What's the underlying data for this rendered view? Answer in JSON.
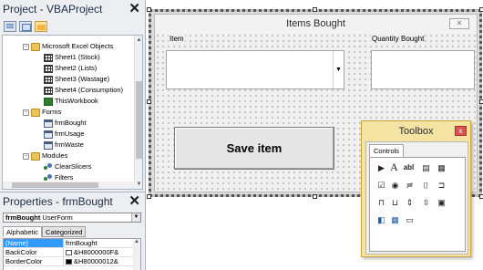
{
  "project": {
    "title": "Project - VBAProject",
    "close": "✕",
    "items": {
      "excel_objects": "Microsoft Excel Objects",
      "sheet1": "Sheet1 (Stock)",
      "sheet2": "Sheet2 (Lists)",
      "sheet3": "Sheet3 (Wastage)",
      "sheet4": "Sheet4 (Consumption)",
      "workbook": "ThisWorkbook",
      "forms": "Forms",
      "frm_bought": "frmBought",
      "frm_usage": "frmUsage",
      "frm_waste": "frmWaste",
      "modules": "Modules",
      "clear_slicers": "ClearSlicers",
      "filters": "Filters"
    }
  },
  "properties": {
    "title": "Properties - frmBought",
    "close": "✕",
    "object_name": "frmBought",
    "object_type": "UserForm",
    "tabs": {
      "alphabetic": "Alphabetic",
      "categorized": "Categorized"
    },
    "rows": [
      {
        "name": "(Name)",
        "value": "frmBought",
        "swatch": ""
      },
      {
        "name": "BackColor",
        "value": "&H8000000F&",
        "swatch": "#ffffff"
      },
      {
        "name": "BorderColor",
        "value": "&H80000012&",
        "swatch": "#000000"
      }
    ]
  },
  "userform": {
    "title": "Items Bought",
    "close": "✕",
    "item_label": "Item",
    "quantity_label": "Quantity Bought",
    "save_button": "Save item"
  },
  "toolbox": {
    "title": "Toolbox",
    "close": "x",
    "tab": "Controls",
    "tools": {
      "pointer": "▶",
      "label": "A",
      "textbox": "abl",
      "combobox": "▤",
      "listbox": "▦",
      "checkbox": "☑",
      "optionbutton": "◉",
      "togglebutton": "≓",
      "frame": "⌷",
      "commandbutton": "⊐",
      "tabstrip": "⊓",
      "multipage": "⊔",
      "scrollbar": "⇕",
      "spinbutton": "⇳",
      "image": "▣",
      "refedit": "◧",
      "calendar": "▦",
      "frame2": "▭"
    }
  }
}
